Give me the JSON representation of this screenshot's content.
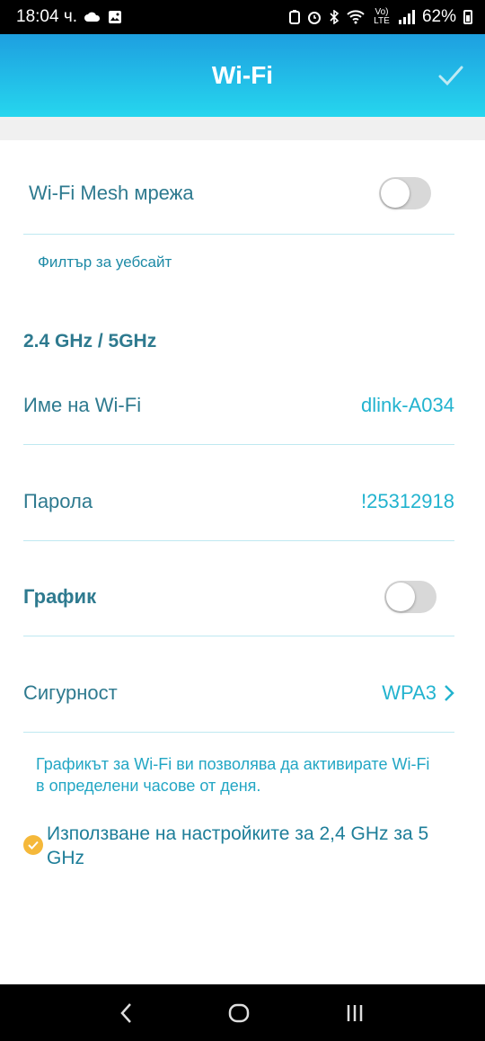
{
  "status_bar": {
    "time": "18:04 ч.",
    "battery": "62%",
    "lte_label": "Vo) LTE",
    "icons": [
      "cloud-icon",
      "image-icon",
      "battery-saver-icon",
      "alarm-icon",
      "bluetooth-icon",
      "wifi-icon",
      "signal-icon",
      "battery-icon"
    ]
  },
  "header": {
    "title": "Wi-Fi",
    "confirm_icon": "check-icon",
    "gradient_top": "#1e9fe0",
    "gradient_bottom": "#26d6ee"
  },
  "mesh": {
    "label": "Wi-Fi Mesh мрежа",
    "enabled": false
  },
  "filter_link": "Филтър за уебсайт",
  "band_title": "2.4 GHz / 5GHz",
  "wifi_name": {
    "label": "Име на Wi-Fi",
    "value": "dlink-A034"
  },
  "password": {
    "label": "Парола",
    "value": "!25312918"
  },
  "schedule": {
    "label": "График",
    "enabled": false
  },
  "security": {
    "label": "Сигурност",
    "value": "WPA3",
    "chevron_icon": "chevron-right-icon"
  },
  "note": "Графикът за Wi-Fi ви позволява да активирате Wi-Fi в определени часове от деня.",
  "use_same": {
    "checked": true,
    "label": "Използване на настройките за 2,4 GHz за 5 GHz",
    "check_color": "#f5b83a"
  },
  "nav_bar": {
    "icons": [
      "back-icon",
      "home-icon",
      "recents-icon"
    ]
  },
  "colors": {
    "accent": "#22b3cf",
    "label": "#2e7a8f",
    "divider": "#bfe9f1"
  }
}
